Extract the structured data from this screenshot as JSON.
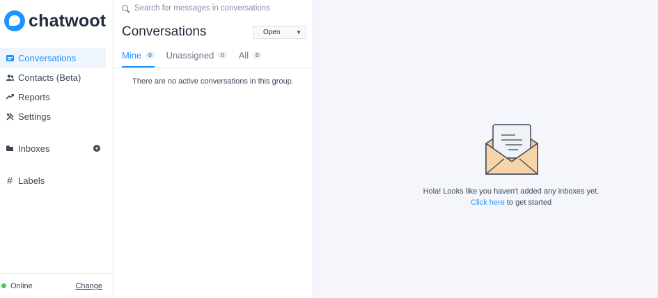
{
  "brand": {
    "name": "chatwoot",
    "accent": "#1f93ff"
  },
  "sidebar": {
    "items": [
      {
        "label": "Conversations",
        "icon": "conversations-icon",
        "active": true
      },
      {
        "label": "Contacts (Beta)",
        "icon": "contacts-icon"
      },
      {
        "label": "Reports",
        "icon": "reports-icon"
      },
      {
        "label": "Settings",
        "icon": "settings-icon"
      }
    ],
    "inboxes": {
      "label": "Inboxes",
      "icon": "folder-icon",
      "add_icon": "add-circle-icon"
    },
    "labels": {
      "label": "Labels",
      "icon": "hash-icon"
    },
    "footer": {
      "status": "Online",
      "status_color": "#44ce4b",
      "change_label": "Change"
    }
  },
  "conversations": {
    "search_placeholder": "Search for messages in conversations",
    "title": "Conversations",
    "status_filter": "Open",
    "tabs": [
      {
        "label": "Mine",
        "count": "0",
        "active": true
      },
      {
        "label": "Unassigned",
        "count": "0"
      },
      {
        "label": "All",
        "count": "0"
      }
    ],
    "empty_text": "There are no active conversations in this group."
  },
  "main": {
    "empty_icon": "envelope-letter-icon",
    "message": "Hola! Looks like you haven't added any inboxes yet.",
    "link_text": "Click here",
    "link_suffix": " to get started"
  }
}
